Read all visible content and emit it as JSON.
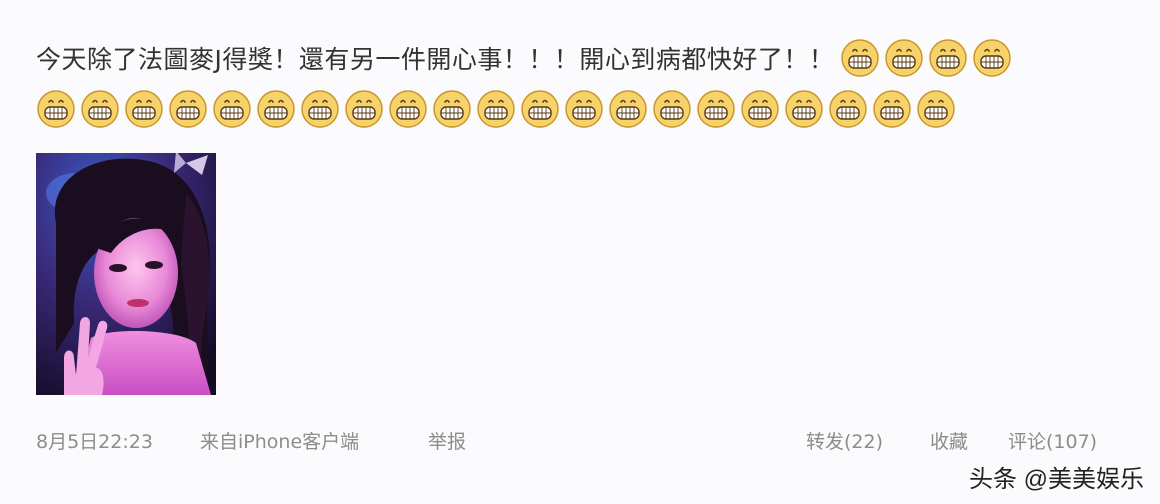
{
  "post": {
    "text": "今天除了法圖麥J得獎！還有另一件開心事！！！開心到病都快好了！！",
    "emoji_icon": "grin-emoji-icon",
    "emoji_count_line1": 4,
    "emoji_count_line2": 21
  },
  "footer": {
    "timestamp": "8月5日22:23",
    "source": "来自iPhone客户端",
    "report": "举报",
    "repost": "转发(22)",
    "favorite": "收藏",
    "comment": "评论(107)"
  },
  "watermark": {
    "text": "头条 @美美娱乐"
  },
  "colors": {
    "emoji_face": "#f6d36a",
    "emoji_outline": "#c9962a",
    "meta_text": "#8c8c8c",
    "photo_tint": "#d65bd0"
  }
}
